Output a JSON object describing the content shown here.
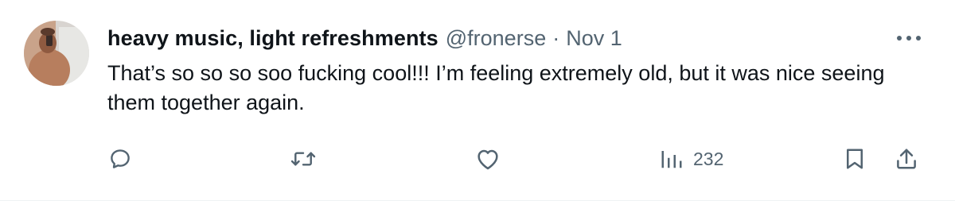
{
  "tweet": {
    "display_name": "heavy music, light refreshments",
    "handle": "@fronerse",
    "separator": "·",
    "date": "Nov 1",
    "text": "That’s so so so soo fucking cool!!! I’m feeling extremely old, but it was nice seeing them together again.",
    "avatar_icon": "profile-photo"
  },
  "actions": {
    "reply_icon": "reply-icon",
    "retweet_icon": "retweet-icon",
    "like_icon": "heart-icon",
    "views_icon": "views-chart-icon",
    "views_count": "232",
    "bookmark_icon": "bookmark-icon",
    "share_icon": "share-icon",
    "more_icon": "more-options-icon"
  },
  "colors": {
    "text_primary": "#0f1419",
    "text_secondary": "#536471",
    "icon": "#536471"
  }
}
